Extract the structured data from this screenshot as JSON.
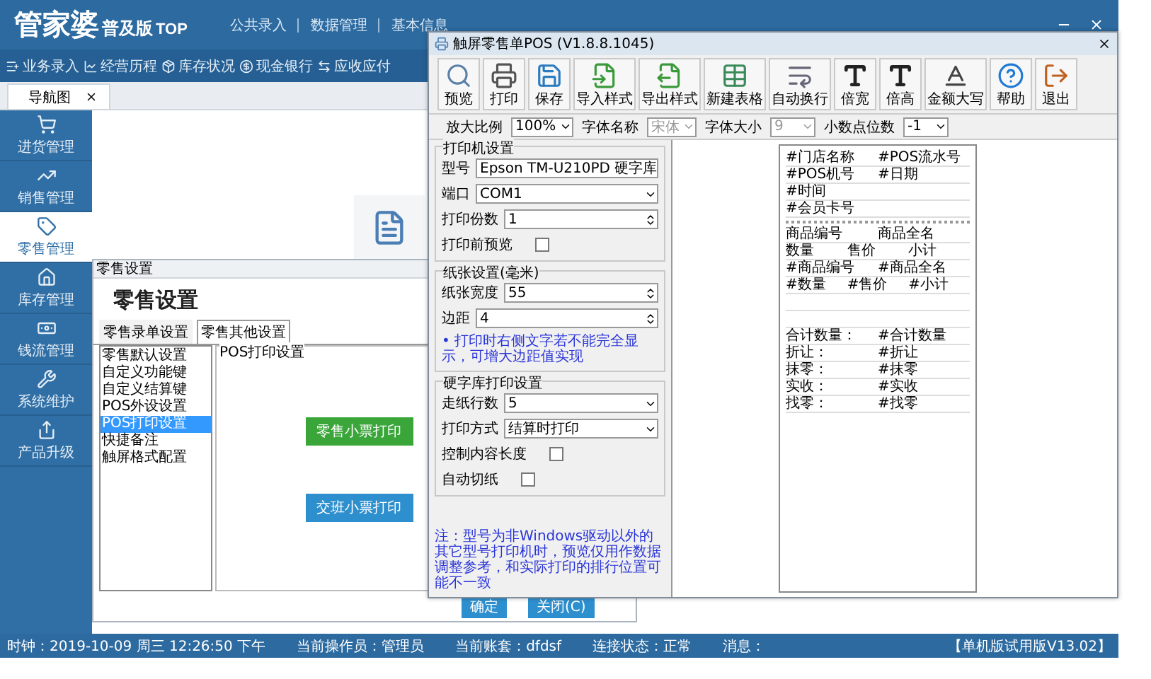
{
  "app": {
    "logo": "管家婆",
    "edition": "普及版",
    "edition_suffix": "TOP",
    "top_menu": [
      "公共录入",
      "数据管理",
      "基本信息"
    ],
    "quick_nav": [
      "业务录入",
      "经营历程",
      "库存状况",
      "现金银行",
      "应收应付"
    ],
    "tabs": [
      {
        "label": "导航图",
        "selected": true
      }
    ],
    "sidebar": [
      {
        "label": "进货管理",
        "selected": false
      },
      {
        "label": "销售管理",
        "selected": false
      },
      {
        "label": "零售管理",
        "selected": true
      },
      {
        "label": "库存管理",
        "selected": false
      },
      {
        "label": "钱流管理",
        "selected": false
      },
      {
        "label": "系统维护",
        "selected": false
      },
      {
        "label": "产品升级",
        "selected": false
      }
    ],
    "status_bar": {
      "items": [
        "时钟：2019-10-09 周三 12:26:50 下午",
        "当前操作员：管理员",
        "当前账套：dfdsf",
        "连接状态：正常",
        "消息："
      ],
      "version": "【单机版试用版V13.02】"
    }
  },
  "settings_dialog": {
    "title": "零售设置",
    "heading": "零售设置",
    "tabs": [
      {
        "label": "零售录单设置",
        "selected": false
      },
      {
        "label": "零售其他设置",
        "selected": true
      }
    ],
    "list": [
      {
        "label": "零售默认设置",
        "selected": false
      },
      {
        "label": "自定义功能键",
        "selected": false
      },
      {
        "label": "自定义结算键",
        "selected": false
      },
      {
        "label": "POS外设设置",
        "selected": false
      },
      {
        "label": "POS打印设置",
        "selected": true
      },
      {
        "label": "快捷备注",
        "selected": false
      },
      {
        "label": "触屏格式配置",
        "selected": false
      }
    ],
    "group_title": "POS打印设置",
    "buttons": [
      {
        "label": "零售小票打印",
        "kind": "primary"
      },
      {
        "label": "交班小票打印",
        "kind": "secondary"
      }
    ],
    "footer_buttons": [
      "确定",
      "关闭(C)"
    ]
  },
  "pos_window": {
    "title": "触屏零售单POS (V1.8.8.1045)",
    "toolbar": [
      "预览",
      "打印",
      "保存",
      "导入样式",
      "导出样式",
      "新建表格",
      "自动换行",
      "倍宽",
      "倍高",
      "金额大写",
      "帮助",
      "退出"
    ],
    "options": [
      {
        "label": "放大比例",
        "value": "100%",
        "disabled": false
      },
      {
        "label": "字体名称",
        "value": "宋体",
        "disabled": true
      },
      {
        "label": "字体大小",
        "value": "9",
        "disabled": true
      },
      {
        "label": "小数点位数",
        "value": "-1",
        "disabled": false
      }
    ],
    "groups": [
      {
        "title": "打印机设置",
        "fields": [
          {
            "kind": "select",
            "label": "型号",
            "value": "Epson TM-U210PD 硬字库"
          },
          {
            "kind": "select",
            "label": "端口",
            "value": "COM1"
          },
          {
            "kind": "spin",
            "label": "打印份数",
            "value": "1"
          },
          {
            "kind": "check",
            "label": "打印前预览",
            "checked": false
          }
        ]
      },
      {
        "title": "纸张设置(毫米)",
        "fields": [
          {
            "kind": "spin",
            "label": "纸张宽度",
            "value": "55"
          },
          {
            "kind": "spin",
            "label": "边距",
            "value": "4"
          }
        ],
        "note": "• 打印时右侧文字若不能完全显示，可增大边距值实现"
      },
      {
        "title": "硬字库打印设置",
        "fields": [
          {
            "kind": "select",
            "label": "走纸行数",
            "value": "5"
          },
          {
            "kind": "select",
            "label": "打印方式",
            "value": "结算时打印"
          },
          {
            "kind": "check",
            "label": "控制内容长度",
            "checked": false
          },
          {
            "kind": "check",
            "label": "自动切纸",
            "checked": false
          }
        ]
      }
    ],
    "footer_note": "注：型号为非Windows驱动以外的其它型号打印机时，预览仅用作数据调整参考，和实际打印的排行位置可能不一致",
    "receipt": [
      {
        "kind": "text",
        "cells": [
          "#门店名称",
          "#POS流水号"
        ]
      },
      {
        "kind": "text",
        "cells": [
          "#POS机号",
          "#日期"
        ]
      },
      {
        "kind": "text",
        "cells": [
          "#时间"
        ]
      },
      {
        "kind": "text",
        "cells": [
          "#会员卡号"
        ]
      },
      {
        "kind": "separator"
      },
      {
        "kind": "text",
        "cells": [
          "商品编号",
          "商品全名"
        ]
      },
      {
        "kind": "text",
        "cells": [
          "数量",
          "售价",
          "小计"
        ]
      },
      {
        "kind": "text",
        "cells": [
          "#商品编号",
          "#商品全名"
        ]
      },
      {
        "kind": "text",
        "cells": [
          "#数量",
          "#售价",
          "#小计"
        ]
      },
      {
        "kind": "blank"
      },
      {
        "kind": "blank"
      },
      {
        "kind": "text",
        "cells": [
          "合计数量：",
          "#合计数量"
        ]
      },
      {
        "kind": "text",
        "cells": [
          "折让：",
          "#折让"
        ]
      },
      {
        "kind": "text",
        "cells": [
          "抹零：",
          "#抹零"
        ]
      },
      {
        "kind": "text",
        "cells": [
          "实收：",
          "#实收"
        ]
      },
      {
        "kind": "text",
        "cells": [
          "找零：",
          "#找零"
        ]
      }
    ]
  }
}
